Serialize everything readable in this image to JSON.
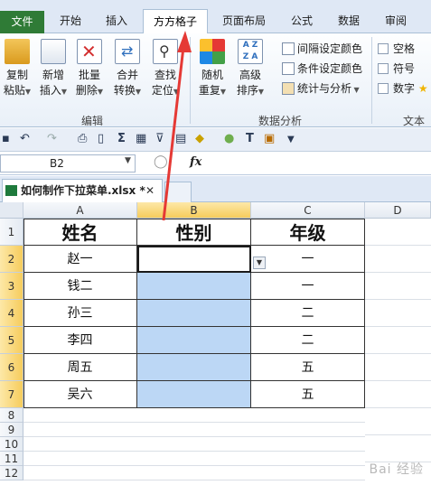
{
  "ribbon_tabs": [
    "文件",
    "开始",
    "插入",
    "方方格子",
    "页面布局",
    "公式",
    "数据",
    "审阅"
  ],
  "active_tab": "方方格子",
  "toolbar": {
    "edit_buttons": [
      {
        "line1": "复制",
        "line2": "粘贴"
      },
      {
        "line1": "新增",
        "line2": "插入"
      },
      {
        "line1": "批量",
        "line2": "删除"
      },
      {
        "line1": "合并",
        "line2": "转换"
      },
      {
        "line1": "查找",
        "line2": "定位"
      }
    ],
    "edit_group_label": "编辑",
    "analysis_buttons": [
      {
        "line1": "随机",
        "line2": "重复"
      },
      {
        "line1": "高级",
        "line2": "排序"
      }
    ],
    "analysis_items": [
      "间隔设定颜色",
      "条件设定颜色",
      "统计与分析"
    ],
    "analysis_group_label": "数据分析",
    "text_items": [
      "空格",
      "符号",
      "数字"
    ],
    "text_group_label": "文本处"
  },
  "formula_bar": {
    "name_box": "B2",
    "fx": "fx",
    "formula": ""
  },
  "document_tab": {
    "name": "如何制作下拉菜单.xlsx *",
    "close": "✕"
  },
  "columns": [
    "A",
    "B",
    "C",
    "D"
  ],
  "rows": [
    "1",
    "2",
    "3",
    "4",
    "5",
    "6",
    "7",
    "8",
    "9",
    "10",
    "11",
    "12"
  ],
  "table": {
    "headers": [
      "姓名",
      "性别",
      "年级"
    ],
    "names": [
      "赵一",
      "钱二",
      "孙三",
      "李四",
      "周五",
      "吴六"
    ],
    "genders": [
      "",
      "",
      "",
      "",
      "",
      ""
    ],
    "grades": [
      "一",
      "一",
      "二",
      "二",
      "五",
      "五"
    ]
  },
  "colors": {
    "accent": "#e53935",
    "selection": "#bcd7f5",
    "file_tab": "#2f7b36"
  }
}
